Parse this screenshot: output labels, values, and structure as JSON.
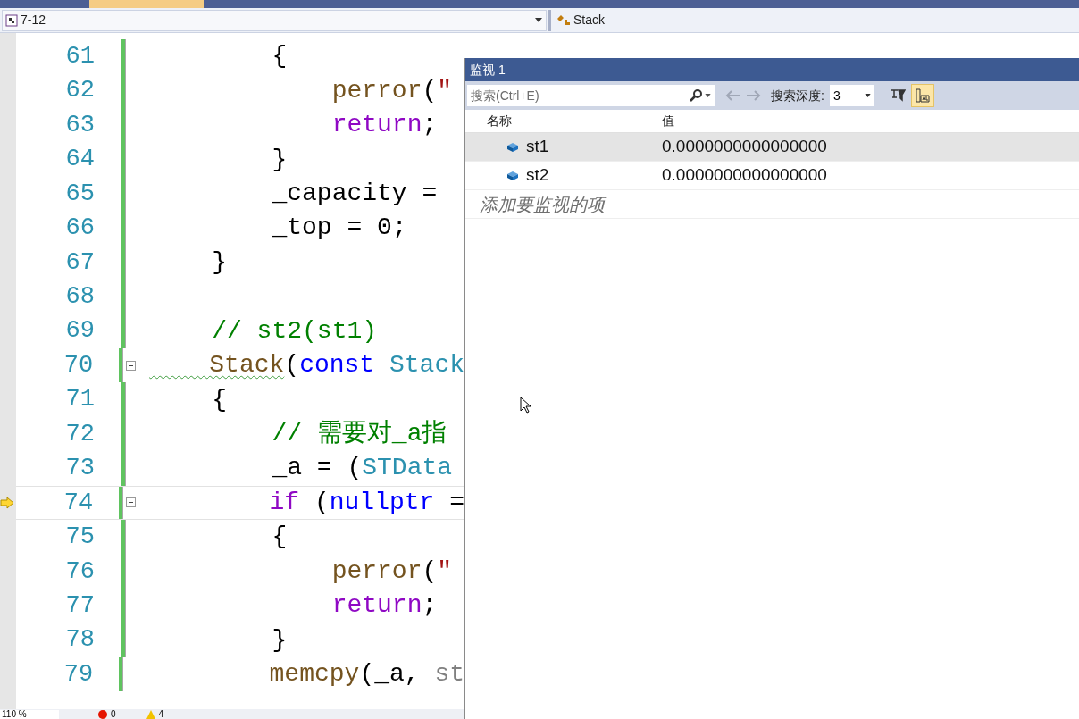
{
  "nav_bar": {
    "scope": "7-12",
    "member": "Stack"
  },
  "editor": {
    "lines": [
      {
        "number": "61",
        "tokens": [
          {
            "kind": "plain",
            "text": "        {"
          }
        ]
      },
      {
        "number": "62",
        "tokens": [
          {
            "kind": "func",
            "text": "            perror"
          },
          {
            "kind": "plain",
            "text": "("
          },
          {
            "kind": "string",
            "text": "\""
          }
        ]
      },
      {
        "number": "63",
        "tokens": [
          {
            "kind": "control",
            "text": "            return"
          },
          {
            "kind": "plain",
            "text": ";"
          }
        ]
      },
      {
        "number": "64",
        "tokens": [
          {
            "kind": "plain",
            "text": "        }"
          }
        ]
      },
      {
        "number": "65",
        "tokens": [
          {
            "kind": "plain",
            "text": "        _capacity = "
          }
        ]
      },
      {
        "number": "66",
        "tokens": [
          {
            "kind": "plain",
            "text": "        _top = 0;"
          }
        ]
      },
      {
        "number": "67",
        "tokens": [
          {
            "kind": "plain",
            "text": "    }"
          }
        ]
      },
      {
        "number": "68"
      },
      {
        "number": "69",
        "tokens": [
          {
            "kind": "comment",
            "text": "    // st2(st1)"
          }
        ]
      },
      {
        "number": "70",
        "collapsible": true,
        "tokens": [
          {
            "kind": "func",
            "text": "    Stack",
            "squiggle": true
          },
          {
            "kind": "plain",
            "text": "("
          },
          {
            "kind": "keyword",
            "text": "const "
          },
          {
            "kind": "type",
            "text": "Stack"
          }
        ]
      },
      {
        "number": "71",
        "tokens": [
          {
            "kind": "plain",
            "text": "    {"
          }
        ]
      },
      {
        "number": "72",
        "tokens": [
          {
            "kind": "comment",
            "text": "        // 需要对_a指"
          }
        ]
      },
      {
        "number": "73",
        "tokens": [
          {
            "kind": "plain",
            "text": "        _a = ("
          },
          {
            "kind": "type",
            "text": "STData"
          }
        ]
      },
      {
        "number": "74",
        "current": true,
        "collapsible": true,
        "tokens": [
          {
            "kind": "control",
            "text": "        if"
          },
          {
            "kind": "plain",
            "text": " ("
          },
          {
            "kind": "keyword",
            "text": "nullptr"
          },
          {
            "kind": "plain",
            "text": " ="
          }
        ]
      },
      {
        "number": "75",
        "tokens": [
          {
            "kind": "plain",
            "text": "        {"
          }
        ]
      },
      {
        "number": "76",
        "tokens": [
          {
            "kind": "func",
            "text": "            perror"
          },
          {
            "kind": "plain",
            "text": "("
          },
          {
            "kind": "string",
            "text": "\""
          }
        ]
      },
      {
        "number": "77",
        "tokens": [
          {
            "kind": "control",
            "text": "            return"
          },
          {
            "kind": "plain",
            "text": ";"
          }
        ]
      },
      {
        "number": "78",
        "tokens": [
          {
            "kind": "plain",
            "text": "        }"
          }
        ]
      },
      {
        "number": "79",
        "tokens": [
          {
            "kind": "func",
            "text": "        memcpy"
          },
          {
            "kind": "plain",
            "text": "(_a, "
          },
          {
            "kind": "param",
            "text": "st"
          }
        ]
      }
    ]
  },
  "watch_window": {
    "title": "监视 1",
    "search": {
      "placeholder": "搜索(Ctrl+E)"
    },
    "depth_label": "搜索深度:",
    "depth_value": "3",
    "columns": [
      "名称",
      "值"
    ],
    "rows": [
      {
        "name": "st1",
        "value": "0.0000000000000000",
        "selected": true
      },
      {
        "name": "st2",
        "value": "0.0000000000000000",
        "selected": false
      }
    ],
    "add_item_placeholder": "添加要监视的项"
  },
  "status_bar": {
    "zoom": "110 %",
    "errors": "0",
    "warnings": "4"
  }
}
